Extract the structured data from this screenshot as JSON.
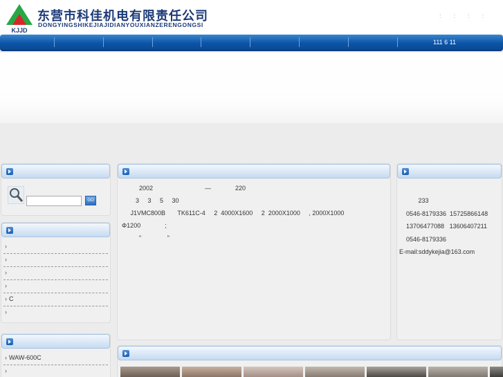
{
  "header": {
    "logo_text": "KJJD",
    "company_cn": "东营市科佳机电有限责任公司",
    "company_en": "DONGYINGSHIKEJIAJIDIANYOUXIANZERENGONGSI",
    "top_links": [
      ":",
      ":",
      ":",
      ":"
    ]
  },
  "nav": {
    "right_text": "111 6 11"
  },
  "search": {
    "placeholder": "",
    "go_label": "GO"
  },
  "categories": [
    "",
    "",
    "",
    "",
    "C",
    ""
  ],
  "products": [
    "WAW-600C",
    ""
  ],
  "about": {
    "lines": [
      "          2002                              —              220",
      "        3     3     5     30",
      "     J1VMC800B       TK611C-4     2  4000X1600     2  2000X1000     , 2000X1000",
      "Φ1200              ;",
      "          \"               \""
    ]
  },
  "contact": {
    "lines": [
      "           233",
      "    0546-8179336  15725866148",
      "    13706477088   13606407211",
      "    0546-8179336",
      "E-mail:sddykejia@163.com"
    ]
  },
  "colors": {
    "nav": "#0d55a8",
    "brand": "#1c3a78",
    "logo_green": "#27a845",
    "logo_red": "#d8262b"
  }
}
